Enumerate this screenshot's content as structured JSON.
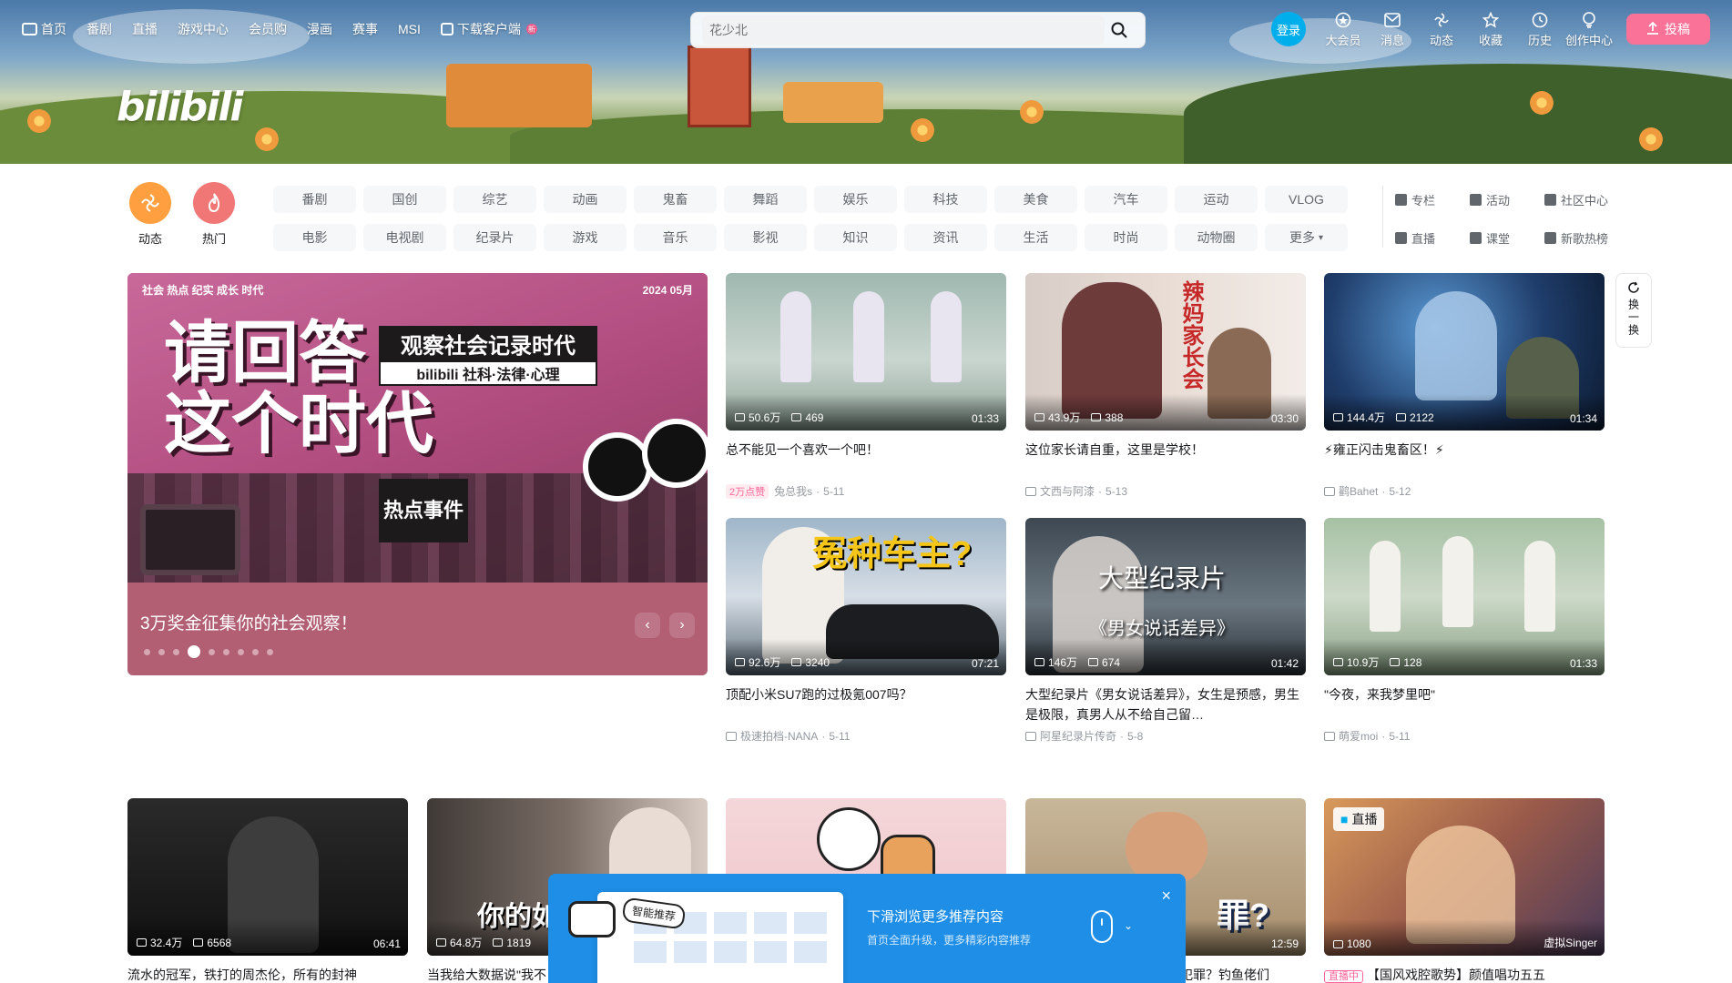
{
  "nav": {
    "left": [
      "首页",
      "番剧",
      "直播",
      "游戏中心",
      "会员购",
      "漫画",
      "赛事",
      "MSI"
    ],
    "download": "下载客户端",
    "new_badge": "新"
  },
  "search": {
    "placeholder": "花少北"
  },
  "right_nav": {
    "login": "登录",
    "items": [
      "大会员",
      "消息",
      "动态",
      "收藏",
      "历史",
      "创作中心"
    ],
    "upload": "投稿"
  },
  "logo": "bilibili",
  "big_channels": [
    "动态",
    "热门"
  ],
  "channels": [
    "番剧",
    "国创",
    "综艺",
    "动画",
    "鬼畜",
    "舞蹈",
    "娱乐",
    "科技",
    "美食",
    "汽车",
    "运动",
    "VLOG",
    "电影",
    "电视剧",
    "纪录片",
    "游戏",
    "音乐",
    "影视",
    "知识",
    "资讯",
    "生活",
    "时尚",
    "动物圈",
    "更多"
  ],
  "side_links": [
    "专栏",
    "活动",
    "社区中心",
    "直播",
    "课堂",
    "新歌热榜"
  ],
  "carousel": {
    "strip_left": "社会 热点 纪实 成长 时代",
    "strip_right": "2024 05月",
    "art_title_1": "请回答",
    "art_title_2": "这个时代",
    "box_a": "观察社会记录时代",
    "box_b": "bilibili 社科·法律·心理",
    "hot": "热点事件",
    "caption": "3万奖金征集你的社会观察！",
    "dots": 9,
    "active_dot": 3
  },
  "refresh": {
    "label": "换一换"
  },
  "cards": [
    {
      "views": "50.6万",
      "danmaku": "469",
      "duration": "01:33",
      "title": "总不能见一个喜欢一个吧！",
      "tag": "2万点赞",
      "author": "兔总我s",
      "date": "5-11"
    },
    {
      "views": "43.9万",
      "danmaku": "388",
      "duration": "03:30",
      "title": "这位家长请自重，这里是学校！",
      "author": "文西与阿漆",
      "date": "5-13"
    },
    {
      "views": "144.4万",
      "danmaku": "2122",
      "duration": "01:34",
      "title": "⚡雍正闪击鬼畜区！⚡",
      "author": "鹳Bahet",
      "date": "5-12"
    },
    {
      "views": "92.6万",
      "danmaku": "3240",
      "duration": "07:21",
      "title": "顶配小米SU7跑的过极氪007吗？",
      "author": "极速拍档-NANA",
      "date": "5-11"
    },
    {
      "views": "146万",
      "danmaku": "674",
      "duration": "01:42",
      "title": "大型纪录片《男女说话差异》，女生是预感，男生是极限，真男人从不给自己留…",
      "author": "阿星纪录片传奇",
      "date": "5-8"
    },
    {
      "views": "10.9万",
      "danmaku": "128",
      "duration": "01:33",
      "title": "\"今夜，来我梦里吧\"",
      "author": "萌爱moi",
      "date": "5-11"
    },
    {
      "views": "32.4万",
      "danmaku": "6568",
      "duration": "06:41",
      "title": "流水的冠军，铁打的周杰伦，所有的封神"
    },
    {
      "views": "64.8万",
      "danmaku": "1819",
      "duration": "",
      "title": "当我给大数据说\"我不"
    },
    {
      "views": "",
      "danmaku": "",
      "duration": "",
      "title": ""
    },
    {
      "views": "",
      "danmaku": "",
      "duration": "12:59",
      "title": "犯罪？钓鱼佬们"
    },
    {
      "views": "1080",
      "danmaku": "",
      "duration": "",
      "title": "【国风戏腔歌势】颜值唱功五五",
      "live_label": "直播",
      "live_tag": "直播中",
      "live_author": "虚拟Singer"
    }
  ],
  "card_texts": {
    "c3_overlay": "冤种车主?",
    "c4_overlay_1": "大型纪录片",
    "c4_overlay_2": "《男女说话差异》",
    "c1_overlay": "辣妈家长会",
    "c7_overlay": "你的如",
    "c9_overlay": "罪?"
  },
  "popup": {
    "smart": "智能推荐",
    "title": "下滑浏览更多推荐内容",
    "subtitle": "首页全面升级，更多精彩内容推荐",
    "close": "×"
  },
  "colors": {
    "accent": "#fb7299",
    "blue": "#00aeec",
    "popup": "#1e8ee6"
  }
}
